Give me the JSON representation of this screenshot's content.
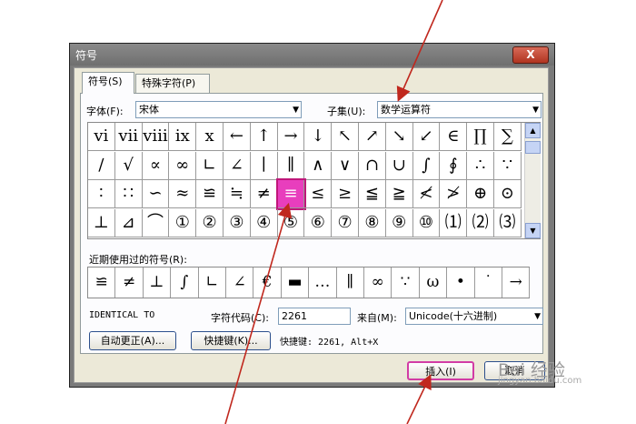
{
  "dialog": {
    "title": "符号",
    "close_label": "X",
    "tabs": [
      "符号(S)",
      "特殊字符(P)"
    ],
    "font_label": "字体(F):",
    "font_value": "宋体",
    "subset_label": "子集(U):",
    "subset_value": "数学运算符",
    "symbols": [
      [
        "ⅵ",
        "ⅶ",
        "ⅷ",
        "ⅸ",
        "ⅹ",
        "←",
        "↑",
        "→",
        "↓",
        "↖",
        "↗",
        "↘",
        "↙",
        "∈",
        "∏",
        "∑"
      ],
      [
        "∕",
        "√",
        "∝",
        "∞",
        "∟",
        "∠",
        "∣",
        "∥",
        "∧",
        "∨",
        "∩",
        "∪",
        "∫",
        "∮",
        "∴",
        "∵"
      ],
      [
        "∶",
        "∷",
        "∽",
        "≈",
        "≌",
        "≒",
        "≠",
        "≡",
        "≤",
        "≥",
        "≦",
        "≧",
        "≮",
        "≯",
        "⊕",
        "⊙"
      ],
      [
        "⊥",
        "⊿",
        "⌒",
        "①",
        "②",
        "③",
        "④",
        "⑤",
        "⑥",
        "⑦",
        "⑧",
        "⑨",
        "⑩",
        "⑴",
        "⑵",
        "⑶"
      ]
    ],
    "selected_symbol": "≡",
    "recent_label": "近期使用过的符号(R):",
    "recent_symbols": [
      "≌",
      "≠",
      "⊥",
      "∫",
      "∟",
      "∠",
      "€",
      "▬",
      "…",
      "∥",
      "∞",
      "∵",
      "ω",
      "•",
      "˙",
      "→"
    ],
    "char_name": "IDENTICAL TO",
    "code_label": "字符代码(C):",
    "code_value": "2261",
    "from_label": "来自(M):",
    "from_value": "Unicode(十六进制)",
    "autocorrect_button": "自动更正(A)...",
    "shortcut_button": "快捷键(K)...",
    "shortcut_text": "快捷键: 2261, Alt+X",
    "insert_button": "插入(I)",
    "cancel_button": "取消"
  },
  "watermark": {
    "text": "Bai 经验",
    "url": "jingyan.baidu.com"
  },
  "colors": {
    "selection": "#e83ebd",
    "annotation_arrow": "#c0281e"
  }
}
